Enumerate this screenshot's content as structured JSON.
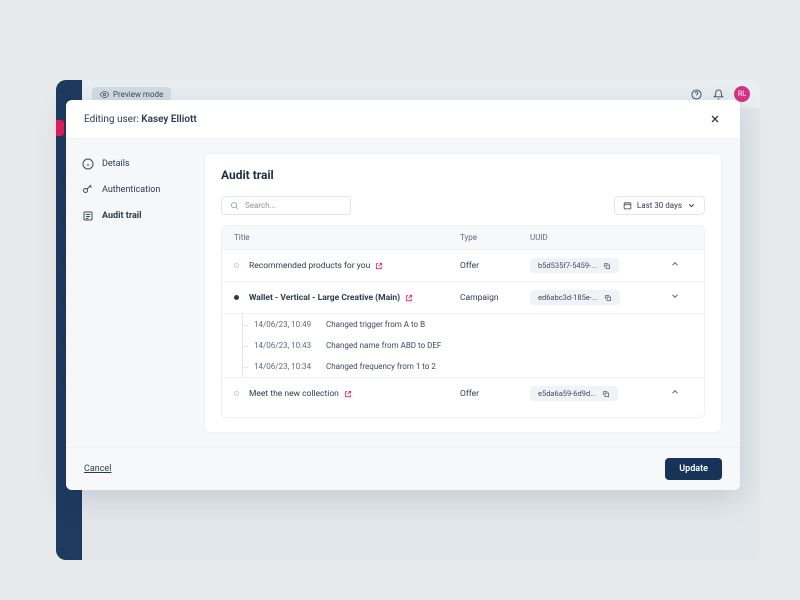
{
  "header": {
    "preview": "Preview mode",
    "avatar": "RL"
  },
  "modal": {
    "prefix": "Editing user: ",
    "name": "Kasey Elliott"
  },
  "nav": {
    "details": "Details",
    "auth": "Authentication",
    "audit": "Audit trail"
  },
  "panel": {
    "title": "Audit trail",
    "search_ph": "Search...",
    "date_filter": "Last 30 days"
  },
  "columns": {
    "title": "Title",
    "type": "Type",
    "uuid": "UUID"
  },
  "rows": [
    {
      "title": "Recommended products for you",
      "type": "Offer",
      "uuid": "b5d535f7-5459-..."
    },
    {
      "title": "Wallet - Vertical - Large Creative (Main)",
      "type": "Campaign",
      "uuid": "ed6abc3d-185e-..."
    },
    {
      "title": "Meet the new collection",
      "type": "Offer",
      "uuid": "e5da6a59-6d9d..."
    }
  ],
  "changes": [
    {
      "time": "14/06/23, 10:49",
      "desc": "Changed trigger from A to B"
    },
    {
      "time": "14/06/23, 10:43",
      "desc": "Changed name from ABD to DEF"
    },
    {
      "time": "14/06/23, 10:34",
      "desc": "Changed frequency from 1 to 2"
    }
  ],
  "footer": {
    "cancel": "Cancel",
    "update": "Update"
  }
}
